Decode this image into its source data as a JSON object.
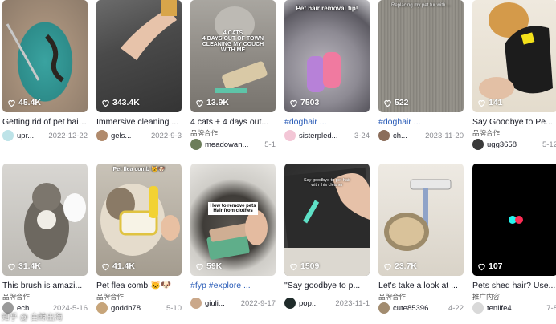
{
  "videos": [
    {
      "title": "Getting rid of pet hair...",
      "views": "45.4K",
      "author": "upr...",
      "date": "2022-12-22",
      "badge": "",
      "tag": false
    },
    {
      "title": "Immersive cleaning ...",
      "views": "343.4K",
      "author": "gels...",
      "date": "2022-9-3",
      "badge": "",
      "tag": false
    },
    {
      "title": "4 cats + 4 days out...",
      "views": "13.9K",
      "author": "meadowan...",
      "date": "5-1",
      "badge": "品牌合作",
      "tag": false,
      "overlay": "4 CATS\n4 DAYS OUT OF TOWN\nCLEANING MY COUCH\nWITH ME"
    },
    {
      "title": "#doghair ...",
      "views": "7503",
      "author": "sisterpled...",
      "date": "3-24",
      "badge": "",
      "tag": true,
      "overlay": "Pet hair removal tip!"
    },
    {
      "title": "#doghair ...",
      "views": "522",
      "author": "ch...",
      "date": "2023-11-20",
      "badge": "",
      "tag": true,
      "overlay": "Replacing my pet fur with ..."
    },
    {
      "title": "Say Goodbye to Pe...",
      "views": "141",
      "author": "ugg3658",
      "date": "5-12",
      "badge": "品牌合作",
      "tag": false
    },
    {
      "title": "This brush is amazi...",
      "views": "31.4K",
      "author": "ech...",
      "date": "2024-5-16",
      "badge": "品牌合作",
      "tag": false
    },
    {
      "title": "Pet flea comb 🐱🐶",
      "views": "41.4K",
      "author": "goddh78",
      "date": "5-10",
      "badge": "品牌合作",
      "tag": false,
      "overlay": "Pet flea comb 🐱🐶"
    },
    {
      "title": "#fyp #explore ...",
      "views": "59K",
      "author": "giuli...",
      "date": "2022-9-17",
      "badge": "",
      "tag": true,
      "overlay": "How to remove pets\nHair from clothes"
    },
    {
      "title": "\"Say goodbye to p...",
      "views": "1509",
      "author": "pop...",
      "date": "2023-11-1",
      "badge": "",
      "tag": false,
      "overlay": "Say goodbye to pet hair\nwith this cleaner"
    },
    {
      "title": "Let's take a look at ...",
      "views": "23.7K",
      "author": "cute85396",
      "date": "4-22",
      "badge": "品牌合作",
      "tag": false
    },
    {
      "title": "Pets shed hair? Use...",
      "views": "107",
      "author": "tenlife4",
      "date": "7-8",
      "badge": "推广内容",
      "tag": false
    }
  ],
  "watermark": "知乎 @ 白鲸出海"
}
